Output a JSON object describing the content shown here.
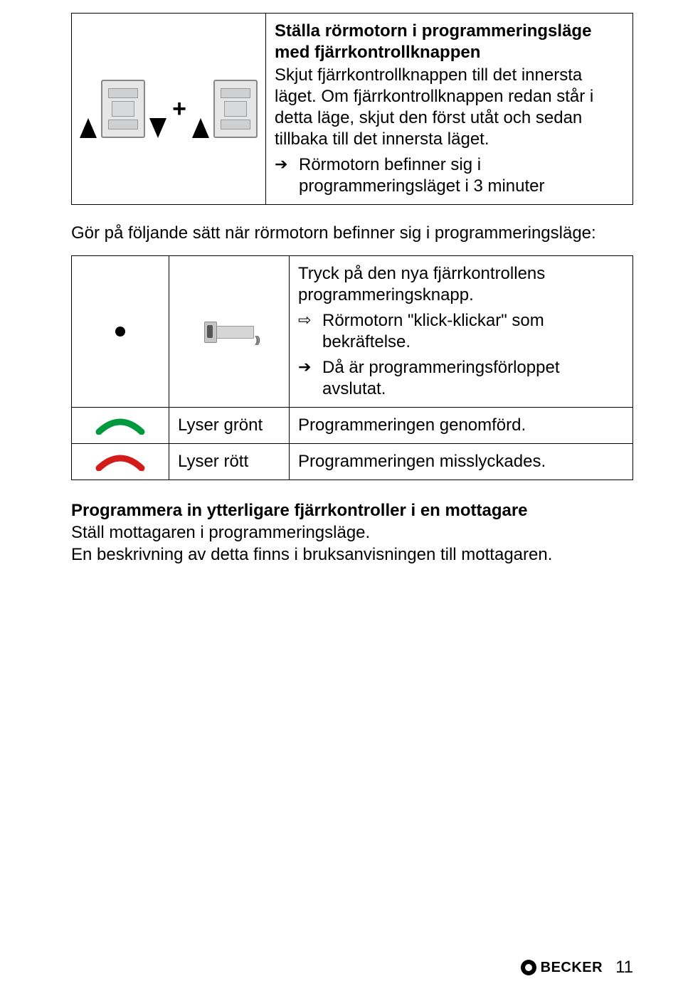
{
  "step1": {
    "title_line1": "Ställa rörmotorn i programmeringsläge",
    "title_line2": "med fjärrkontrollknappen",
    "body1": "Skjut fjärrkontrollknappen till det innersta läget. Om fjärrkontrollknappen redan står i detta läge, skjut den först utåt och sedan tillbaka till det innersta läget.",
    "arrow_text": "Rörmotorn befinner sig i programmeringsläget i 3 minuter"
  },
  "intermediate_para": "Gör på följande sätt när rörmotorn befinner sig i programmeringsläge:",
  "step2": {
    "body1": "Tryck på den nya fjärrkontrollens programmeringsknapp.",
    "sub_arrow": "Rörmotorn \"klick-klickar\" som bekräftelse.",
    "arrow_text": "Då är programmeringsförloppet avslutat."
  },
  "row_green": {
    "label": "Lyser grönt",
    "result": "Programmeringen genomförd."
  },
  "row_red": {
    "label": "Lyser rött",
    "result": "Programmeringen misslyckades."
  },
  "section": {
    "title": "Programmera in ytterligare fjärrkontroller i en mottagare",
    "line1": "Ställ mottagaren i programmeringsläge.",
    "line2": "En beskrivning av detta finns i bruksanvisningen till mottagaren."
  },
  "footer": {
    "brand": "BECKER",
    "page": "11"
  },
  "icons": {
    "motor_illustration": "motor-switch-diagram",
    "remote_prog_button": "remote-programming-button",
    "led_green": "led-arc-green",
    "led_red": "led-arc-red"
  }
}
